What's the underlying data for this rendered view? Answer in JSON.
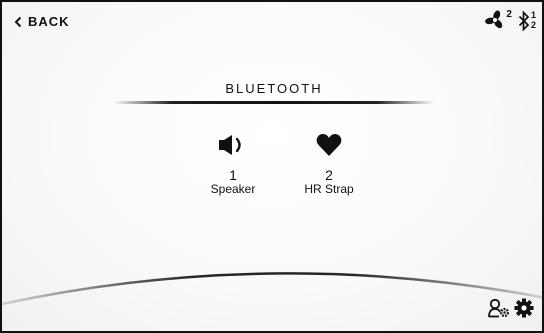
{
  "header": {
    "back_label": "BACK",
    "back_icon": "chevron-left-icon"
  },
  "status": {
    "fan": {
      "icon": "fan-icon",
      "count": "2"
    },
    "bluetooth": {
      "icon": "bluetooth-icon",
      "count_top": "1",
      "count_bottom": "2"
    }
  },
  "main": {
    "title": "BLUETOOTH",
    "devices": [
      {
        "icon": "speaker-icon",
        "count": "1",
        "label": "Speaker"
      },
      {
        "icon": "heart-icon",
        "count": "2",
        "label": "HR Strap"
      }
    ]
  },
  "footer": {
    "user_settings_icon": "user-settings-icon",
    "settings_icon": "gear-icon"
  }
}
